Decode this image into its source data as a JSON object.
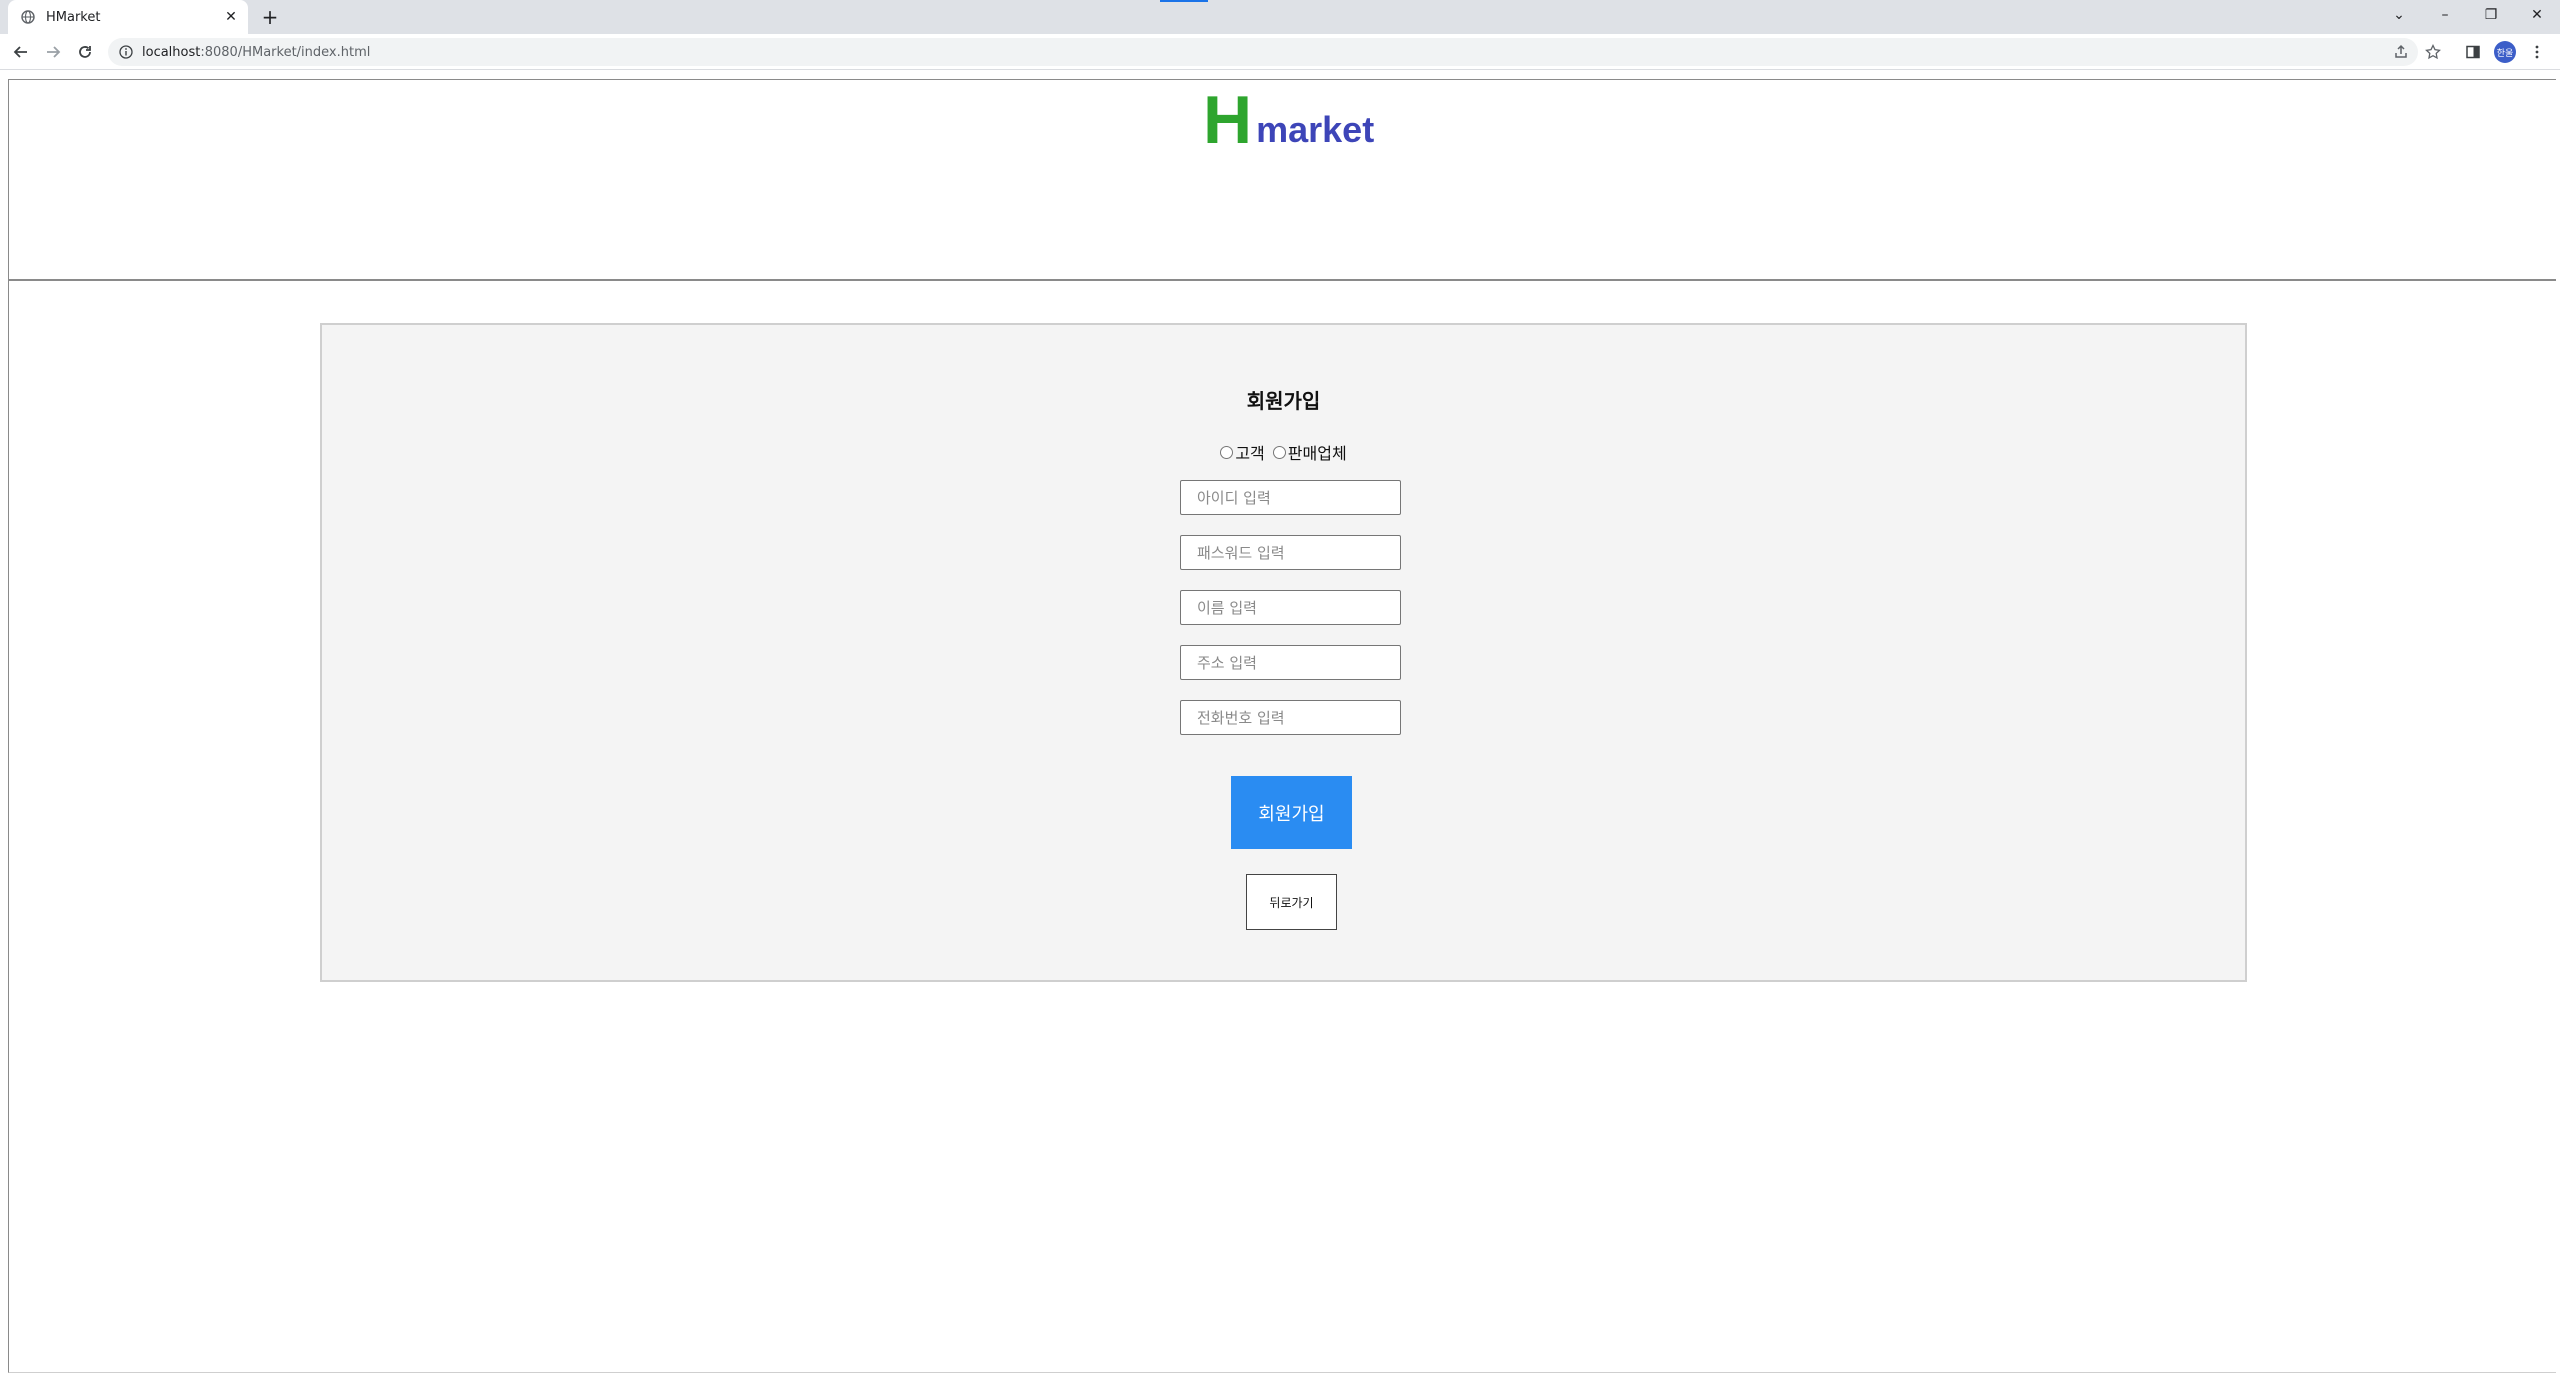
{
  "browser": {
    "tab_title": "HMarket",
    "new_tab": "+",
    "tab_close": "✕",
    "url_host": "localhost",
    "url_rest": ":8080/HMarket/index.html",
    "profile_label": "한울",
    "window_controls": {
      "dropdown": "⌄",
      "minimize": "–",
      "restore": "❐",
      "close": "✕"
    }
  },
  "header": {
    "logo_h": "H",
    "logo_market": "market"
  },
  "signup": {
    "title": "회원가입",
    "radio_options": [
      "고객",
      "판매업체"
    ],
    "fields": [
      {
        "name": "id-field",
        "placeholder": "아이디 입력"
      },
      {
        "name": "password-field",
        "placeholder": "패스워드 입력"
      },
      {
        "name": "name-field",
        "placeholder": "이름 입력"
      },
      {
        "name": "address-field",
        "placeholder": "주소 입력"
      },
      {
        "name": "phone-field",
        "placeholder": "전화번호 입력"
      }
    ],
    "submit_label": "회원가입",
    "back_label": "뒤로가기"
  },
  "colors": {
    "logo_h": "#2ea52e",
    "logo_market": "#3d45b8",
    "submit_button": "#2a8cf2"
  }
}
